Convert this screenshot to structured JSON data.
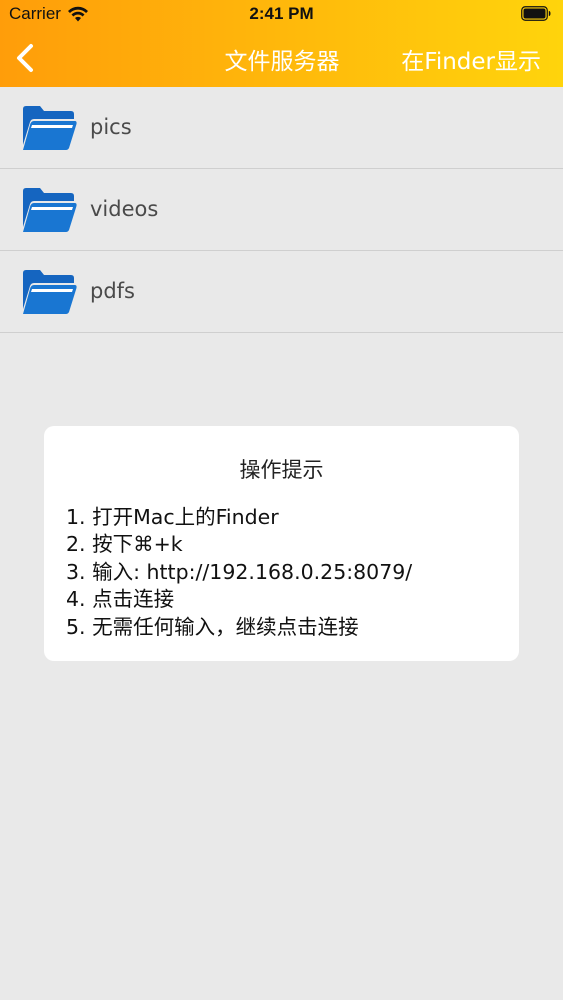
{
  "status_bar": {
    "carrier": "Carrier",
    "time": "2:41 PM"
  },
  "nav": {
    "title": "文件服务器",
    "right_button": "在Finder显示",
    "back_icon": "chevron-left-icon"
  },
  "folders": [
    {
      "name": "pics",
      "icon": "folder-icon"
    },
    {
      "name": "videos",
      "icon": "folder-icon"
    },
    {
      "name": "pdfs",
      "icon": "folder-icon"
    }
  ],
  "tip": {
    "title": "操作提示",
    "lines": [
      "1. 打开Mac上的Finder",
      "2. 按下⌘+k",
      "3. 输入: http://192.168.0.25:8079/",
      "4. 点击连接",
      "5. 无需任何输入，继续点击连接"
    ]
  },
  "colors": {
    "header_start": "#ff9d0a",
    "header_end": "#ffd40c",
    "folder_blue": "#1565c0",
    "background": "#e9e9e9"
  }
}
